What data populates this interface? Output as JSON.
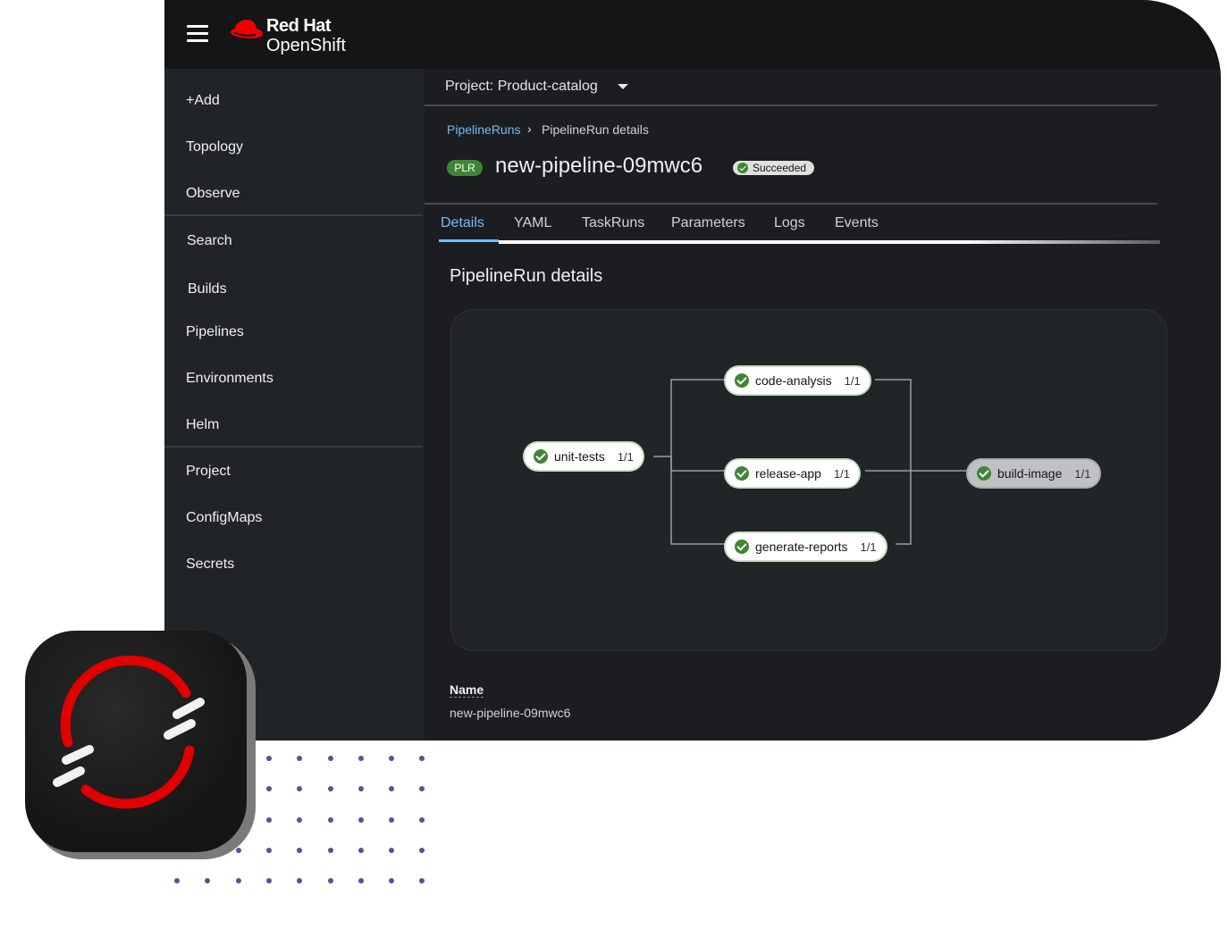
{
  "brand": {
    "line1": "Red Hat",
    "line2": "OpenShift",
    "accent": "#ee0000"
  },
  "sidebar": {
    "items": [
      {
        "label": "+Add"
      },
      {
        "label": "Topology"
      },
      {
        "label": "Observe"
      },
      {
        "label": "Search"
      },
      {
        "label": "Builds"
      },
      {
        "label": "Pipelines"
      },
      {
        "label": "Environments"
      },
      {
        "label": "Helm"
      },
      {
        "label": "Project"
      },
      {
        "label": "ConfigMaps"
      },
      {
        "label": "Secrets"
      }
    ]
  },
  "project": {
    "label": "Project: Product-catalog"
  },
  "breadcrumb": {
    "parent": "PipelineRuns",
    "separator": "›",
    "current": "PipelineRun details"
  },
  "run": {
    "badge": "PLR",
    "title": "new-pipeline-09mwc6",
    "status": "Succeeded",
    "status_color": "#3e8635"
  },
  "tabs": [
    {
      "label": "Details"
    },
    {
      "label": "YAML"
    },
    {
      "label": "TaskRuns"
    },
    {
      "label": "Parameters"
    },
    {
      "label": "Logs"
    },
    {
      "label": "Events"
    }
  ],
  "section": {
    "title": "PipelineRun details"
  },
  "pipeline": {
    "tasks": [
      {
        "name": "unit-tests",
        "count": "1/1"
      },
      {
        "name": "code-analysis",
        "count": "1/1"
      },
      {
        "name": "release-app",
        "count": "1/1"
      },
      {
        "name": "generate-reports",
        "count": "1/1"
      },
      {
        "name": "build-image",
        "count": "1/1"
      }
    ]
  },
  "details": {
    "name_label": "Name",
    "name_value": "new-pipeline-09mwc6"
  }
}
